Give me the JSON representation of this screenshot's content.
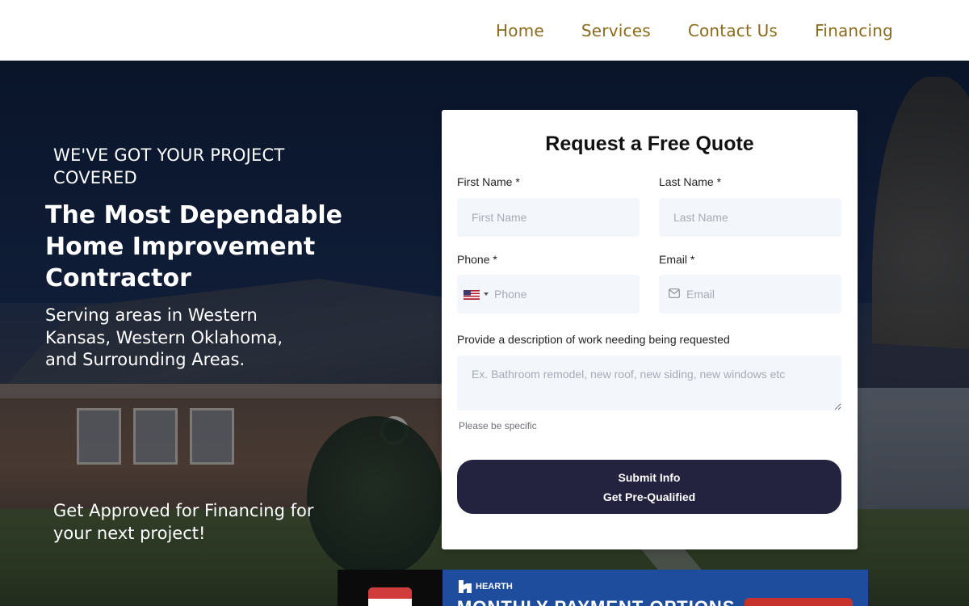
{
  "nav": {
    "items": [
      "Home",
      "Services",
      "Contact Us",
      "Financing"
    ],
    "color": "#8a6a1c"
  },
  "hero": {
    "eyebrow": "WE'VE GOT YOUR PROJECT COVERED",
    "headline": "The Most Dependable Home Improvement Contractor",
    "subhead": "Serving areas in Western Kansas, Western Oklahoma, and Surrounding Areas.",
    "financing_text": "Get Approved for Financing for your next project!"
  },
  "form": {
    "title": "Request a Free Quote",
    "first_name": {
      "label": "First Name",
      "required": "*",
      "placeholder": "First Name",
      "value": ""
    },
    "last_name": {
      "label": "Last Name",
      "required": "*",
      "placeholder": "Last Name",
      "value": ""
    },
    "phone": {
      "label": "Phone",
      "required": "*",
      "placeholder": "Phone",
      "value": "",
      "flag_icon": "us-flag-icon"
    },
    "email": {
      "label": "Email",
      "required": "*",
      "placeholder": "Email",
      "value": "",
      "icon": "mail-icon"
    },
    "description": {
      "label": "Provide a description of work needing being requested",
      "placeholder": "Ex. Bathroom remodel, new roof, new siding, new windows etc",
      "hint": "Please be specific",
      "value": ""
    },
    "submit": {
      "line1": "Submit Info",
      "line2": "Get Pre-Qualified",
      "color": "#23223f"
    }
  },
  "banner": {
    "brand": "HEARTH",
    "headline": "MONTHLY PAYMENT OPTIONS",
    "color": "#1d4d9c",
    "cta_color": "#c8322c"
  }
}
